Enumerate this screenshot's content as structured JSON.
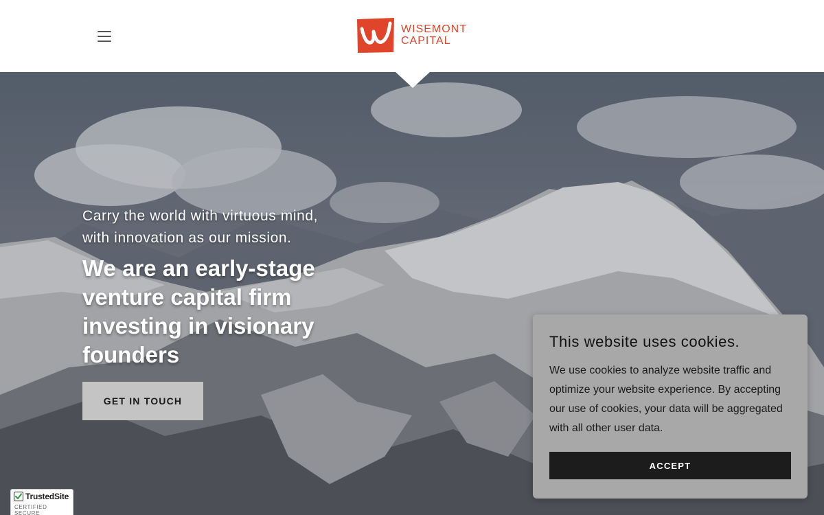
{
  "header": {
    "brand_line1": "WISEMONT",
    "brand_line2": "CAPITAL",
    "brand_color": "#e0452b"
  },
  "hero": {
    "tagline_line1": "Carry the world with virtuous mind,",
    "tagline_line2": "with innovation as our mission.",
    "headline": "We are an early-stage venture capital firm investing in visionary founders",
    "cta_label": "GET IN TOUCH",
    "background": "snow-capped-mountain-photo"
  },
  "cookie_banner": {
    "title": "This website uses cookies.",
    "body": "We use cookies to analyze website traffic and optimize your website experience. By accepting our use of cookies, your data will be aggregated with all other user data.",
    "accept_label": "ACCEPT"
  },
  "trust_badge": {
    "name": "TrustedSite",
    "subtitle": "CERTIFIED SECURE"
  },
  "icons": {
    "menu": "hamburger-menu-icon",
    "logo": "wisemont-w-logo-icon",
    "badge": "check-icon"
  }
}
